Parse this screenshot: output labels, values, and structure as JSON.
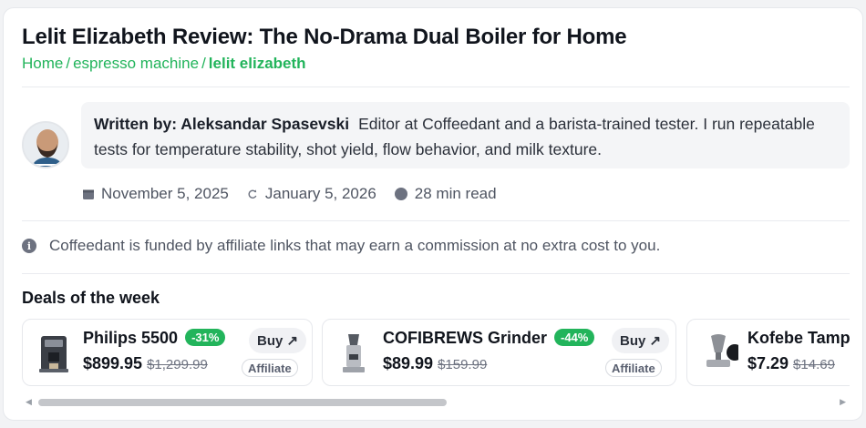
{
  "article": {
    "title": "Lelit Elizabeth Review: The No-Drama Dual Boiler for Home",
    "breadcrumb": {
      "home": "Home",
      "sep1": "/",
      "category": "espresso machine",
      "sep2": "/",
      "current": "lelit elizabeth"
    }
  },
  "author": {
    "written_by": "Written by: Aleksandar Spasevski",
    "bio": "Editor at Coffeedant and a barista-trained tester. I run repeatable tests for temperature stability, shot yield, flow behavior, and milk texture."
  },
  "meta": {
    "published": "November 5, 2025",
    "updated": "January 5, 2026",
    "read_time": "28 min read"
  },
  "disclosure": {
    "text": "Coffeedant is funded by affiliate links that may earn a commission at no extra cost to you."
  },
  "deals": {
    "heading": "Deals of the week",
    "items": [
      {
        "name": "Philips 5500",
        "discount": "-31%",
        "price": "$899.95",
        "was": "$1,299.99",
        "buy": "Buy ↗",
        "affiliate": "Affiliate",
        "icon": "espresso-machine-icon"
      },
      {
        "name": "COFIBREWS Grinder",
        "discount": "-44%",
        "price": "$89.99",
        "was": "$159.99",
        "buy": "Buy ↗",
        "affiliate": "Affiliate",
        "icon": "coffee-grinder-icon"
      },
      {
        "name": "Kofebe Tamp",
        "price": "$7.29",
        "was": "$14.69",
        "icon": "tamper-icon"
      }
    ]
  },
  "colors": {
    "accent": "#22b45b",
    "text": "#11151d",
    "muted": "#4f5562"
  }
}
